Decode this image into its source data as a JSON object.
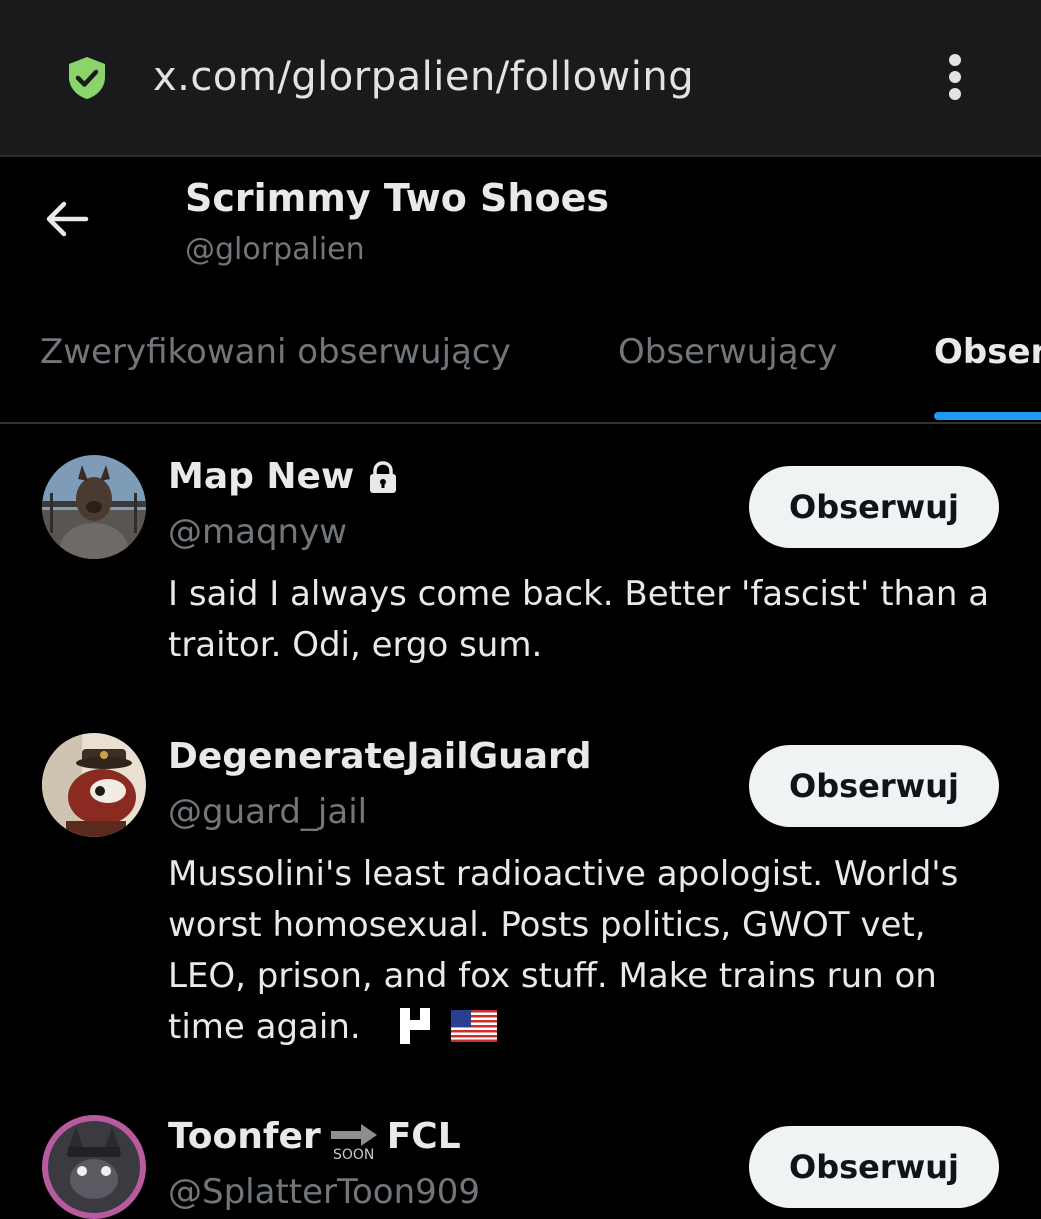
{
  "browser": {
    "url": "x.com/glorpalien/following",
    "security_icon": "shield-check-icon",
    "menu_icon": "more-vertical-icon"
  },
  "profile": {
    "back_icon": "arrow-left-icon",
    "name": "Scrimmy Two Shoes",
    "handle": "@glorpalien"
  },
  "tabs": [
    {
      "label": "Zweryfikowani obserwujący",
      "active": false
    },
    {
      "label": "Obserwujący",
      "active": false
    },
    {
      "label": "Obserwowani",
      "active": true
    }
  ],
  "users": [
    {
      "name": "Map New",
      "handle": "@maqnyw",
      "protected": true,
      "bio": "I said I always come back. Better 'fascist' than a traitor. Odi, ergo sum.",
      "follow_label": "Obserwuj"
    },
    {
      "name": "DegenerateJailGuard",
      "handle": "@guard_jail",
      "bio": "Mussolini's least radioactive apologist. World's worst homosexual. Posts politics, GWOT vet, LEO, prison, and fox stuff. Make trains run on time again.",
      "bio_emojis": [
        "flag-icon",
        "us-flag-icon"
      ],
      "follow_label": "Obserwuj"
    },
    {
      "name_part1": "Toonfer",
      "name_emoji_label": "SOON",
      "name_part2": "FCL",
      "handle": "@SplatterToon909",
      "follow_label": "Obserwuj"
    }
  ],
  "colors": {
    "background": "#000000",
    "urlbar": "#181a1c",
    "accent": "#1d9bf0",
    "muted_text": "#71767b",
    "button_bg": "#eff3f4",
    "shield": "#8bd46a"
  }
}
